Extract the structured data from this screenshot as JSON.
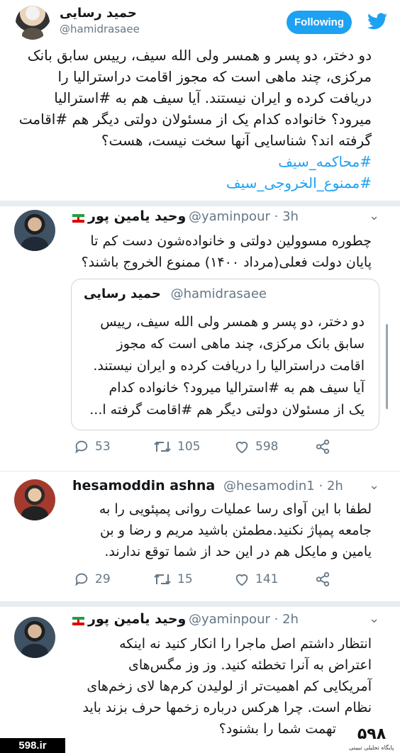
{
  "main_tweet": {
    "name": "حمید رسایی",
    "handle": "@hamidrasaee",
    "follow_label": "Following",
    "lines": [
      "دو دختر، دو پسر و همسر ولی الله سیف، رییس سابق بانک",
      "مرکزی، چند ماهی است که مجوز اقامت دراسترالیا را",
      "دریافت کرده و ایران نیستند. آیا سیف هم به #استرالیا",
      "میرود؟ خانواده کدام یک از مسئولان دولتی دیگر هم #اقامت",
      "گرفته اند؟ شناسایی آنها سخت نیست، هست؟",
      "#محاکمه_سیف",
      "#ممنوع_الخروجی_سیف"
    ]
  },
  "reply1": {
    "name": "وحید یامین پور",
    "handle": "@yaminpour",
    "time": "3h",
    "lines": [
      "چطوره مسوولین دولتی و خانواده‌شون دست کم تا",
      "پایان دولت فعلی(مرداد ۱۴۰۰) ممنوع الخروج باشند؟"
    ],
    "quote": {
      "name": "حمید رسایی",
      "handle": "@hamidrasaee",
      "lines": [
        "دو دختر، دو پسر و همسر ولی الله سیف، رییس",
        "سابق بانک مرکزی، چند ماهی است که مجوز",
        "اقامت دراسترالیا را دریافت کرده و ایران نیستند.",
        "آیا سیف هم به #استرالیا میرود؟ خانواده کدام",
        "یک از مسئولان دولتی دیگر هم #اقامت گرفته ا..."
      ]
    },
    "replies": "53",
    "retweets": "105",
    "likes": "598"
  },
  "reply2": {
    "name": "hesamoddin ashna",
    "handle": "@hesamodin1",
    "time": "2h",
    "lines": [
      "لطفا با این آوای رسا عملیات روانی پمپئویی را  به",
      "جامعه پمپاژ نکنید.مطمئن باشید مریم و رضا و بن",
      "یامین و مایکل هم در این حد از شما توقع ندارند."
    ],
    "replies": "29",
    "retweets": "15",
    "likes": "141"
  },
  "reply3": {
    "name": "وحید یامین پور",
    "handle": "@yaminpour",
    "time": "2h",
    "lines": [
      "انتظار داشتم اصل ماجرا را انکار کنید نه اینکه",
      "اعتراض به آنرا تخطئه کنید. وز وز مگس‌های",
      "آمریکایی کم اهمیت‌تر از لولیدن کرم‌ها لای زخم‌های",
      "نظام است. چرا هرکس درباره زخمها حرف بزند باید",
      "تهمت شما را بشنود؟"
    ]
  },
  "watermark": {
    "site": "598.ir",
    "logo": "۵۹۸",
    "sub": "پایگاه تحلیلی تبیینی"
  },
  "colors": {
    "accent": "#1da1f2",
    "muted": "#657786",
    "divider": "#e6ecf0"
  }
}
